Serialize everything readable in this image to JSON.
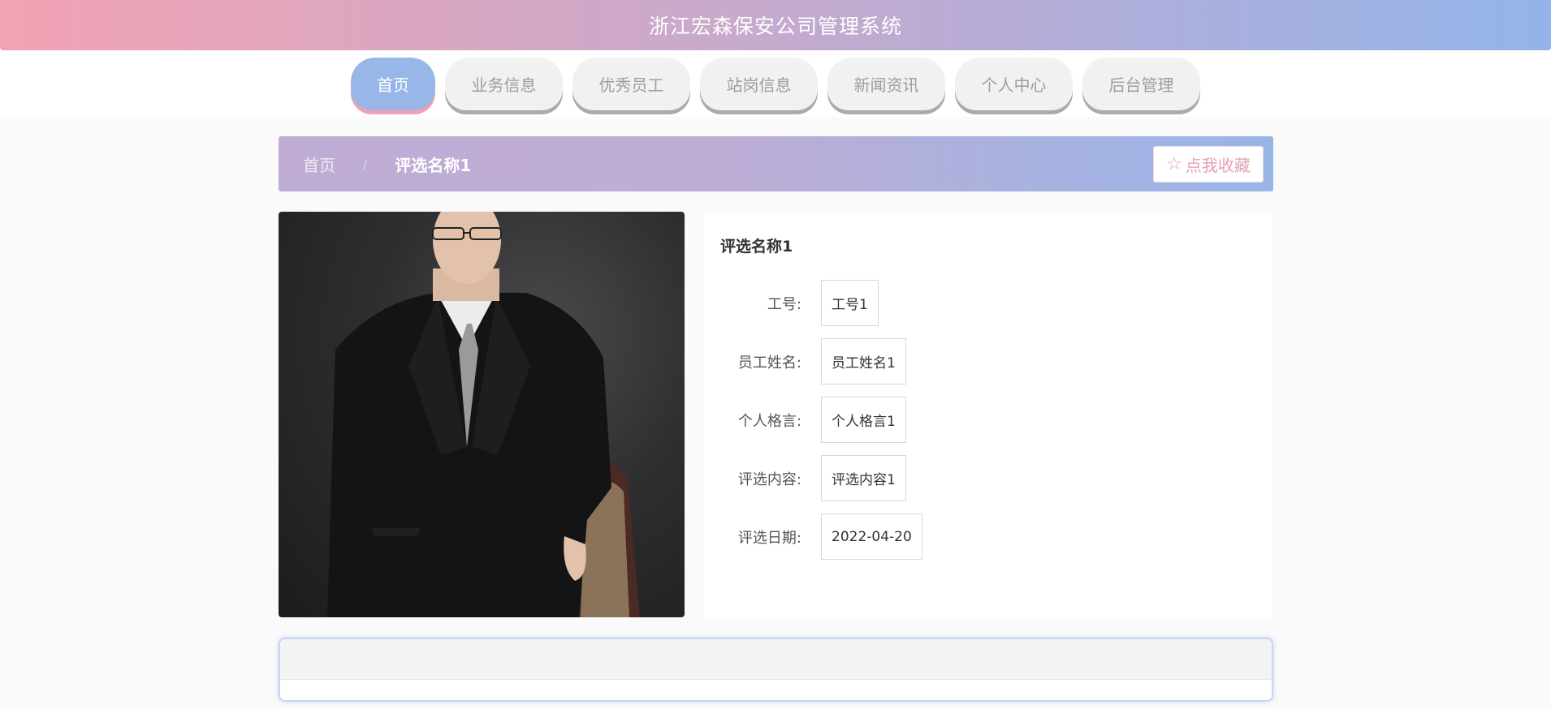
{
  "header": {
    "title": "浙江宏森保安公司管理系统"
  },
  "nav": {
    "items": [
      {
        "label": "首页",
        "active": true
      },
      {
        "label": "业务信息"
      },
      {
        "label": "优秀员工"
      },
      {
        "label": "站岗信息"
      },
      {
        "label": "新闻资讯"
      },
      {
        "label": "个人中心"
      },
      {
        "label": "后台管理"
      }
    ]
  },
  "breadcrumb": {
    "home": "首页",
    "separator": "/",
    "current": "评选名称1"
  },
  "favorite": {
    "icon": "star-outline-icon",
    "label": "点我收藏"
  },
  "detail": {
    "title": "评选名称1",
    "fields": [
      {
        "label": "工号:",
        "value": "工号1"
      },
      {
        "label": "员工姓名:",
        "value": "员工姓名1"
      },
      {
        "label": "个人格言:",
        "value": "个人格言1"
      },
      {
        "label": "评选内容:",
        "value": "评选内容1"
      },
      {
        "label": "评选日期:",
        "value": "2022-04-20"
      }
    ]
  },
  "colors": {
    "accent_blue": "#99b6e8",
    "accent_pink": "#f2a2b3",
    "accent_purple": "#bfacd4"
  }
}
